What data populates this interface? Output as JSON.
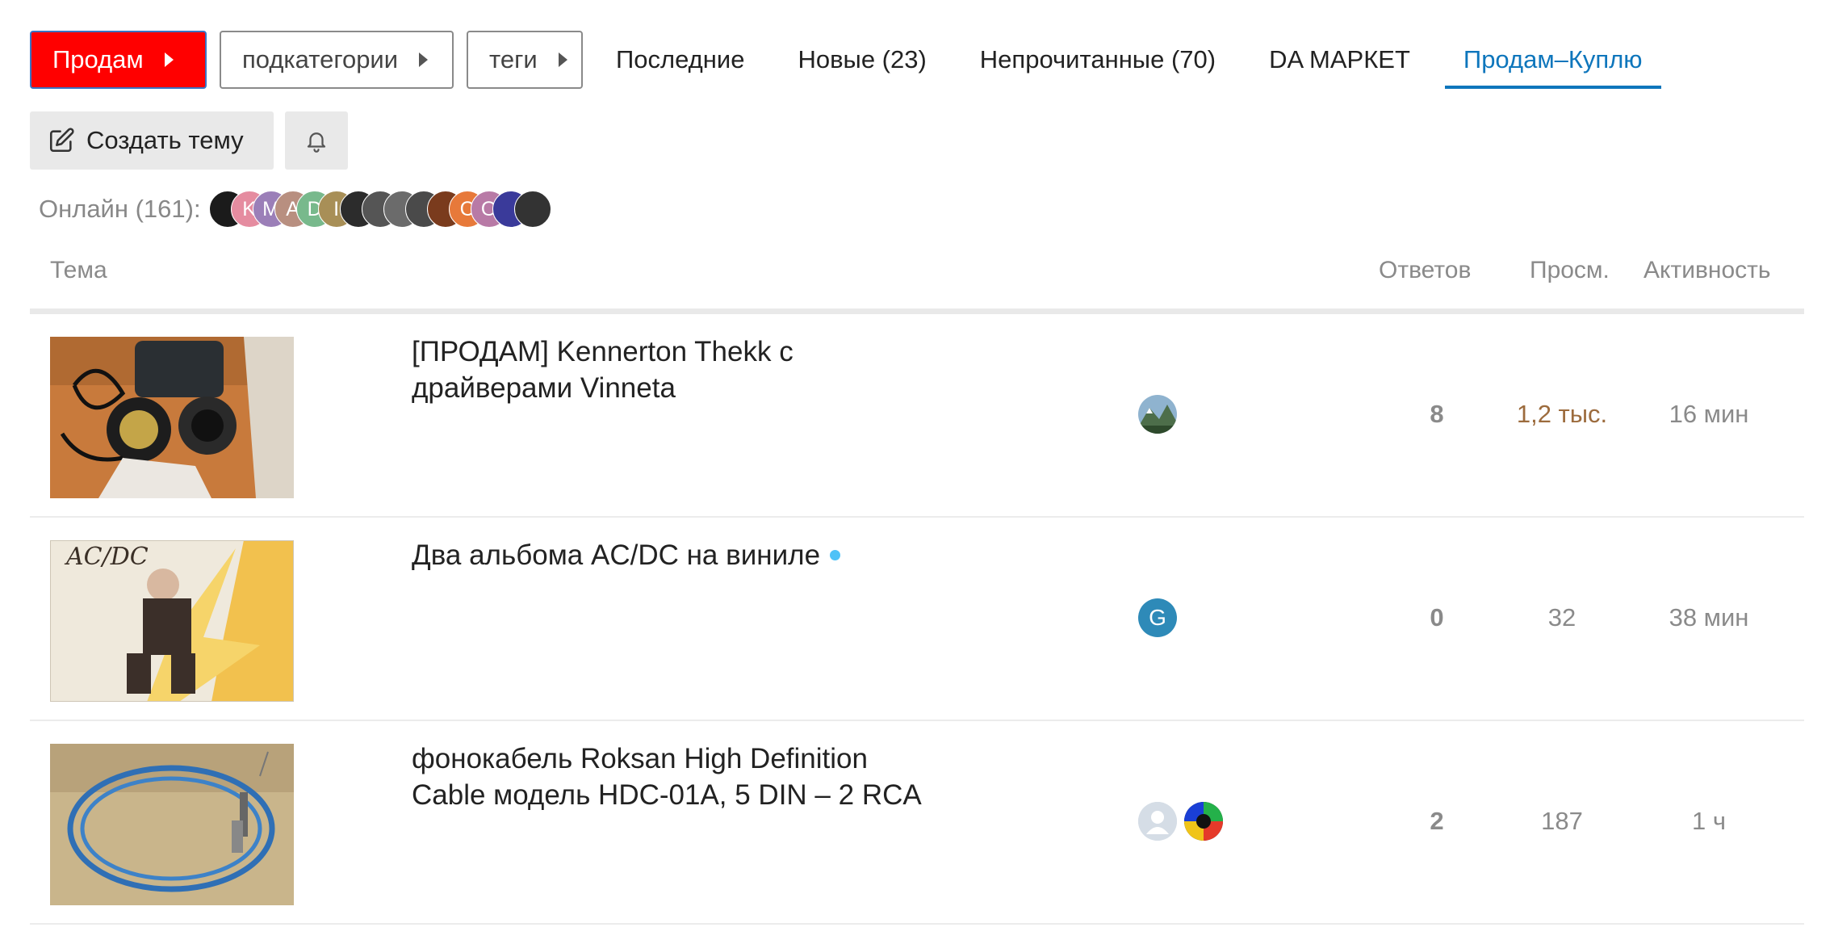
{
  "nav": {
    "category": "Продам",
    "subcategories": "подкатегории",
    "tags": "теги",
    "tabs": [
      {
        "label": "Последние"
      },
      {
        "label": "Новые (23)"
      },
      {
        "label": "Непрочитанные (70)"
      },
      {
        "label": "DA МАРКЕТ"
      },
      {
        "label": "Продам–Куплю",
        "active": true
      }
    ]
  },
  "actions": {
    "create_topic": "Создать тему",
    "notifications_icon": "bell-icon",
    "create_icon": "pencil-square-icon"
  },
  "online": {
    "label": "Онлайн (161):",
    "users": [
      {
        "letter": "",
        "color": "#1b1b1b"
      },
      {
        "letter": "K",
        "color": "#e58ca0"
      },
      {
        "letter": "M",
        "color": "#9b7fb8"
      },
      {
        "letter": "A",
        "color": "#b88f80"
      },
      {
        "letter": "D",
        "color": "#78b98c"
      },
      {
        "letter": "I",
        "color": "#a88f57"
      },
      {
        "letter": "",
        "color": "#2c2c2c"
      },
      {
        "letter": "",
        "color": "#555555"
      },
      {
        "letter": "",
        "color": "#6b6b6b"
      },
      {
        "letter": "",
        "color": "#4a4a4a"
      },
      {
        "letter": "",
        "color": "#7a3b1d"
      },
      {
        "letter": "C",
        "color": "#e7793a"
      },
      {
        "letter": "O",
        "color": "#b87aa6"
      },
      {
        "letter": "",
        "color": "#3a3a9a"
      },
      {
        "letter": "",
        "color": "#333333"
      }
    ]
  },
  "table": {
    "headers": {
      "topic": "Тема",
      "replies": "Ответов",
      "views": "Просм.",
      "activity": "Активность"
    },
    "rows": [
      {
        "title": "[ПРОДАМ] Kennerton Thekk с драйверами Vinneta",
        "replies": "8",
        "views": "1,2 тыс.",
        "activity": "16 мин",
        "thumb_icon": "headphones-photo",
        "posters": [
          "mountain-avatar"
        ]
      },
      {
        "title": "Два альбома AC/DC на виниле",
        "unread": true,
        "replies": "0",
        "views": "32",
        "activity": "38 мин",
        "thumb_icon": "acdc-vinyl-photo",
        "posters": [
          {
            "letter": "G",
            "color": "#2e8ab8"
          }
        ]
      },
      {
        "title": "фонокабель Roksan High Definition Cable модель HDC-01A, 5 DIN – 2 RCA",
        "replies": "2",
        "views": "187",
        "activity": "1 ч",
        "thumb_icon": "cable-photo",
        "posters": [
          "default-user-avatar",
          "colorful-avatar"
        ]
      }
    ]
  },
  "colors": {
    "primary_category": "#ff0000",
    "active_tab": "#0e76bc",
    "hot_views": "#9c6b3d",
    "new_dot": "#4ec2f7"
  }
}
